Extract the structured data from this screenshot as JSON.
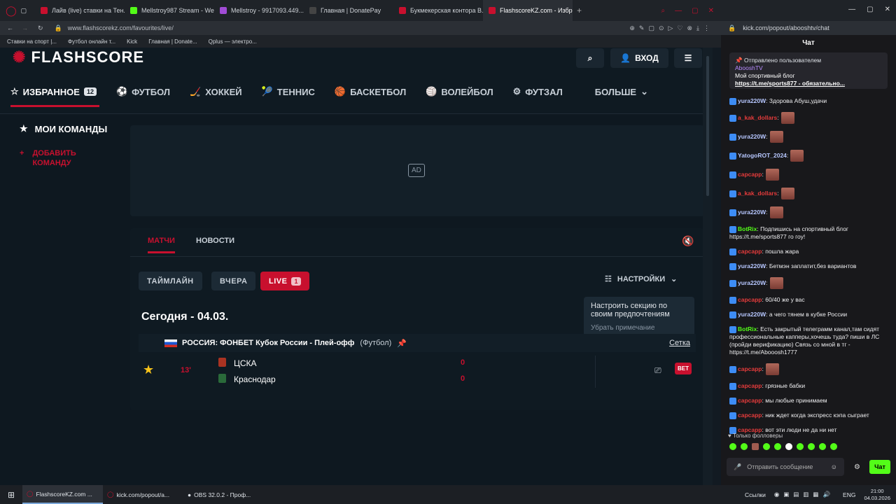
{
  "browser": {
    "tabs": [
      {
        "label": "Лайв (live) ставки на Тен...",
        "color": "#c8102e"
      },
      {
        "label": "Mellstroy987 Stream - We...",
        "color": "#53fc18"
      },
      {
        "label": "Mellstroy - 9917093.449...",
        "color": "#a14cd6"
      },
      {
        "label": "Главная | DonatePay",
        "color": "#2c2c2c"
      },
      {
        "label": "Букмекерская контора В...",
        "color": "#c8102e"
      },
      {
        "label": "FlashscoreKZ.com - Избр...",
        "color": "#c8102e",
        "active": true
      }
    ],
    "url": "www.flashscorekz.com/favourites/live/",
    "bookmarks": [
      "Ставки на спорт |...",
      "Футбол онлайн т...",
      "Kick",
      "Главная | Donate...",
      "Qplus — электро..."
    ],
    "chat_url": "kick.com/popout/abooshtv/chat"
  },
  "flashscore": {
    "logo": "FLASHSCORE",
    "login_label": "ВХОД",
    "nav": [
      {
        "label": "ИЗБРАННОЕ",
        "badge": "12",
        "icon": "star-icon"
      },
      {
        "label": "ФУТБОЛ",
        "icon": "soccer-ball-icon"
      },
      {
        "label": "ХОККЕЙ",
        "icon": "hockey-icon"
      },
      {
        "label": "ТЕННИС",
        "icon": "tennis-icon"
      },
      {
        "label": "БАСКЕТБОЛ",
        "icon": "basketball-icon"
      },
      {
        "label": "ВОЛЕЙБОЛ",
        "icon": "volleyball-icon"
      },
      {
        "label": "ФУТЗАЛ",
        "icon": "futsal-icon"
      }
    ],
    "more_label": "БОЛЬШЕ",
    "my_teams": "МОИ КОМАНДЫ",
    "add_team": "ДОБАВИТЬ КОМАНДУ",
    "ad_label": "AD",
    "tabs": {
      "matches": "МАТЧИ",
      "news": "НОВОСТИ"
    },
    "filters": {
      "timeline": "ТАЙМЛАЙН",
      "yesterday": "ВЧЕРА",
      "live": "LIVE",
      "live_count": "1"
    },
    "settings_label": "НАСТРОЙКИ",
    "tooltip": {
      "text": "Настроить секцию по своим предпочтениям",
      "dismiss": "Убрать примечание"
    },
    "date_heading": "Сегодня - 04.03.",
    "league": {
      "name": "РОССИЯ: ФОНБЕТ Кубок России - Плей-офф",
      "sport": "(Футбол)",
      "bracket": "Сетка"
    },
    "match": {
      "minute": "13'",
      "home": "ЦСКА",
      "away": "Краснодар",
      "home_score": "0",
      "away_score": "0",
      "bet": "BET"
    }
  },
  "chat": {
    "title": "Чат",
    "pinned": {
      "header": "Отправлено пользователем",
      "user": "AbooshTV",
      "text": "Мой спортивный блог",
      "link": "https://t.me/sports877 - обязательно..."
    },
    "messages": [
      {
        "user": "yura220W",
        "color": "#b7c7ff",
        "text": ": Здорова Абуш,удачи"
      },
      {
        "user": "a_kak_dollars",
        "color": "#e53b3b",
        "text": ":"
      },
      {
        "user": "yura220W",
        "color": "#b7c7ff",
        "text": ":"
      },
      {
        "user": "YatogoROT_2024",
        "color": "#b7c7ff",
        "text": ":"
      },
      {
        "user": "capcapp",
        "color": "#e53b3b",
        "text": ":"
      },
      {
        "user": "a_kak_dollars",
        "color": "#e53b3b",
        "text": ":"
      },
      {
        "user": "yura220W",
        "color": "#b7c7ff",
        "text": ":"
      },
      {
        "user": "BotRix",
        "color": "#53fc18",
        "text": ": Подпишись на спортивный блог https://t.me/sports877 го гоу!"
      },
      {
        "user": "capcapp",
        "color": "#e53b3b",
        "text": ": пошла жара"
      },
      {
        "user": "yura220W",
        "color": "#b7c7ff",
        "text": ": Бетмэн заплатит,без вариантов"
      },
      {
        "user": "yura220W",
        "color": "#b7c7ff",
        "text": ":"
      },
      {
        "user": "capcapp",
        "color": "#e53b3b",
        "text": ": 60/40 же у вас"
      },
      {
        "user": "yura220W",
        "color": "#b7c7ff",
        "text": ": а чего тянем в кубке России"
      },
      {
        "user": "BotRix",
        "color": "#53fc18",
        "text": ": Есть закрытый телеграмм канал,там сидят профессиональные капперы,хочешь туда? пиши в ЛС (пройди верификацию) Связь со мной в тг - https://t.me/Abooosh1777"
      },
      {
        "user": "capcapp",
        "color": "#e53b3b",
        "text": ":"
      },
      {
        "user": "capcapp",
        "color": "#e53b3b",
        "text": ": грязные бабки"
      },
      {
        "user": "capcapp",
        "color": "#e53b3b",
        "text": ": мы любые принимаем"
      },
      {
        "user": "capcapp",
        "color": "#e53b3b",
        "text": ": ник ждет когда экспресс кэпа сыграет"
      },
      {
        "user": "capcapp",
        "color": "#e53b3b",
        "text": ": вот эти люди не да ни нет"
      }
    ],
    "followers_only": "Только фолловеры",
    "input_placeholder": "Отправить сообщение",
    "send_label": "Чат"
  },
  "taskbar": {
    "items": [
      "FlashscoreKZ.com ...",
      "kick.com/popout/a...",
      "OBS 32.0.2 - Проф..."
    ],
    "tray_links": "Ссылки",
    "lang": "ENG",
    "time": "21:00",
    "date": "04.03.2026"
  }
}
